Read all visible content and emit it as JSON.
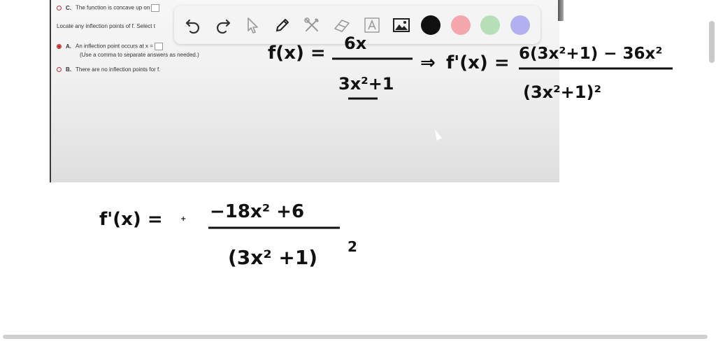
{
  "screenshot": {
    "option_c": {
      "letter": "C.",
      "text": "The function is concave up on"
    },
    "question": "Locate any inflection points of f. Select t",
    "option_a": {
      "letter": "A.",
      "text": "An inflection point occurs at x =",
      "note": "(Use a comma to separate answers as needed.)"
    },
    "option_b": {
      "letter": "B.",
      "text": "There are no inflection points for f."
    }
  },
  "toolbar": {
    "tools": [
      "undo-icon",
      "redo-icon",
      "select-pointer-icon",
      "pen-icon",
      "tools-icon",
      "eraser-icon",
      "text-icon",
      "image-icon"
    ],
    "colors": [
      "#111111",
      "#f4a6ad",
      "#b8e0b8",
      "#b3b0f0"
    ]
  },
  "handwriting": {
    "fx": "f(x) =",
    "fx_num": "6x",
    "fx_den": "3x²+1",
    "implies": "⇒",
    "fpx_top": "f'(x) =",
    "fpx_top_num": "6(3x²+1) − 36x²",
    "fpx_top_den": "(3x²+1)²",
    "fpx": "f'(x) =",
    "fpx_num": "−18x² +6",
    "fpx_den": "(3x² +1)",
    "fpx_den_exp": "2"
  }
}
